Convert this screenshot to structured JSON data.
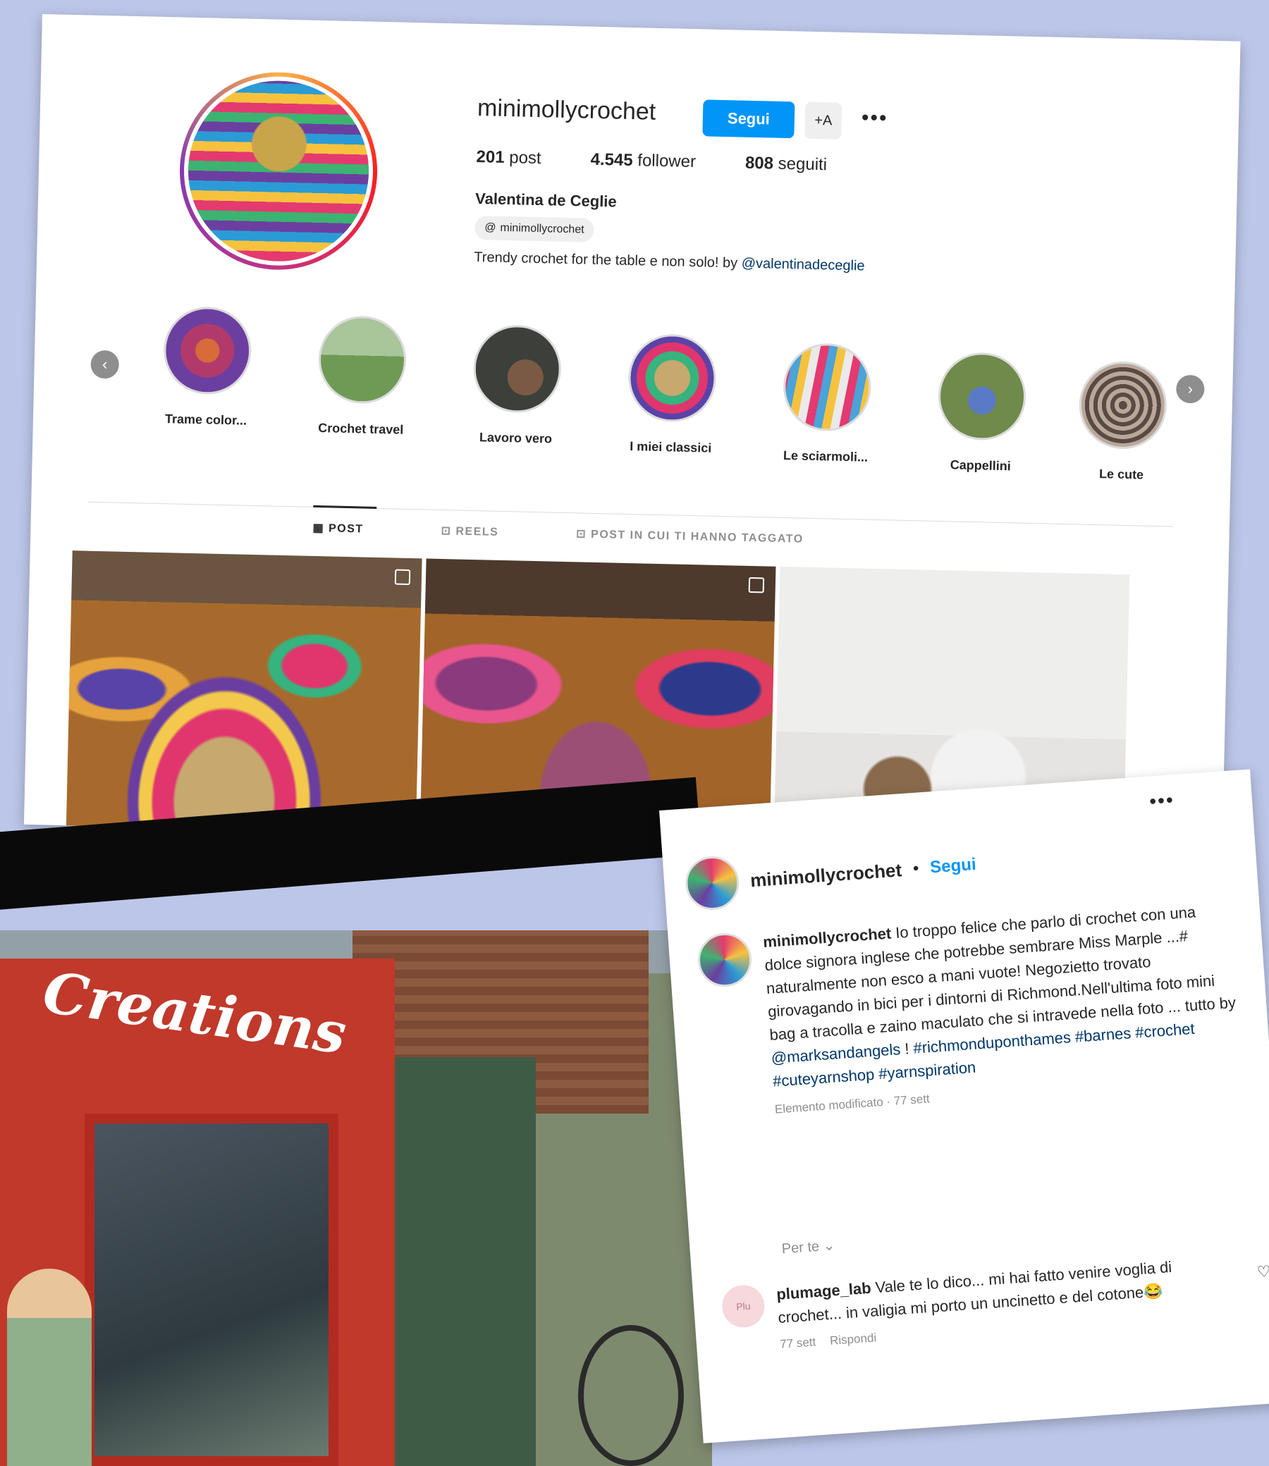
{
  "profile": {
    "username": "minimollycrochet",
    "follow_label": "Segui",
    "suggest_label": "+A",
    "more_label": "•••",
    "stats": {
      "posts_value": "201",
      "posts_label": "post",
      "followers_value": "4.545",
      "followers_label": "follower",
      "following_value": "808",
      "following_label": "seguiti"
    },
    "full_name": "Valentina de Ceglie",
    "threads_handle": "minimollycrochet",
    "bio_text": "Trendy crochet for the table e non solo! by ",
    "bio_link": "@valentinadeceglie"
  },
  "highlights": [
    {
      "label": "Trame color..."
    },
    {
      "label": "Crochet travel"
    },
    {
      "label": "Lavoro vero"
    },
    {
      "label": "I miei classici"
    },
    {
      "label": "Le sciarmoli..."
    },
    {
      "label": "Cappellini"
    },
    {
      "label": "Le cute"
    }
  ],
  "tabs": {
    "post": "POST",
    "reels": "REELS",
    "tagged": "POST IN CUI TI HANNO TAGGATO"
  },
  "post": {
    "username": "minimollycrochet",
    "separator": "•",
    "follow_label": "Segui",
    "more_label": "•••",
    "caption_user": "minimollycrochet",
    "caption_text": "Io troppo felice che parlo di crochet con una dolce signora inglese che potrebbe sembrare Miss Marple ...# naturalmente non esco a mani vuote! Negozietto trovato girovagando in bici per i dintorni di Richmond.Nell'ultima foto mini bag a tracolla e zaino maculato che si intravede nella foto ... tutto by ",
    "caption_mention": "@marksandangels",
    "caption_bang": " !",
    "caption_hashtags": "#richmonduponthames #barnes #crochet #cuteyarnshop #yarnspiration",
    "edited_meta": "Elemento modificato · 77 sett",
    "for_you": "Per te ⌄",
    "comment": {
      "avatar_text": "Plu",
      "user": "plumage_lab",
      "text": " Vale te lo dico... mi hai fatto venire voglia di crochet... in valigia mi porto un uncinetto e del cotone😂",
      "time": "77 sett",
      "reply": "Rispondi"
    },
    "heart_icon": "♡"
  },
  "street_photo": {
    "sign_text": "Creations"
  },
  "colors": {
    "background": "#bcc6e8",
    "accent_blue": "#0095f6",
    "link_blue": "#00376b",
    "muted": "#8e8e8e"
  }
}
